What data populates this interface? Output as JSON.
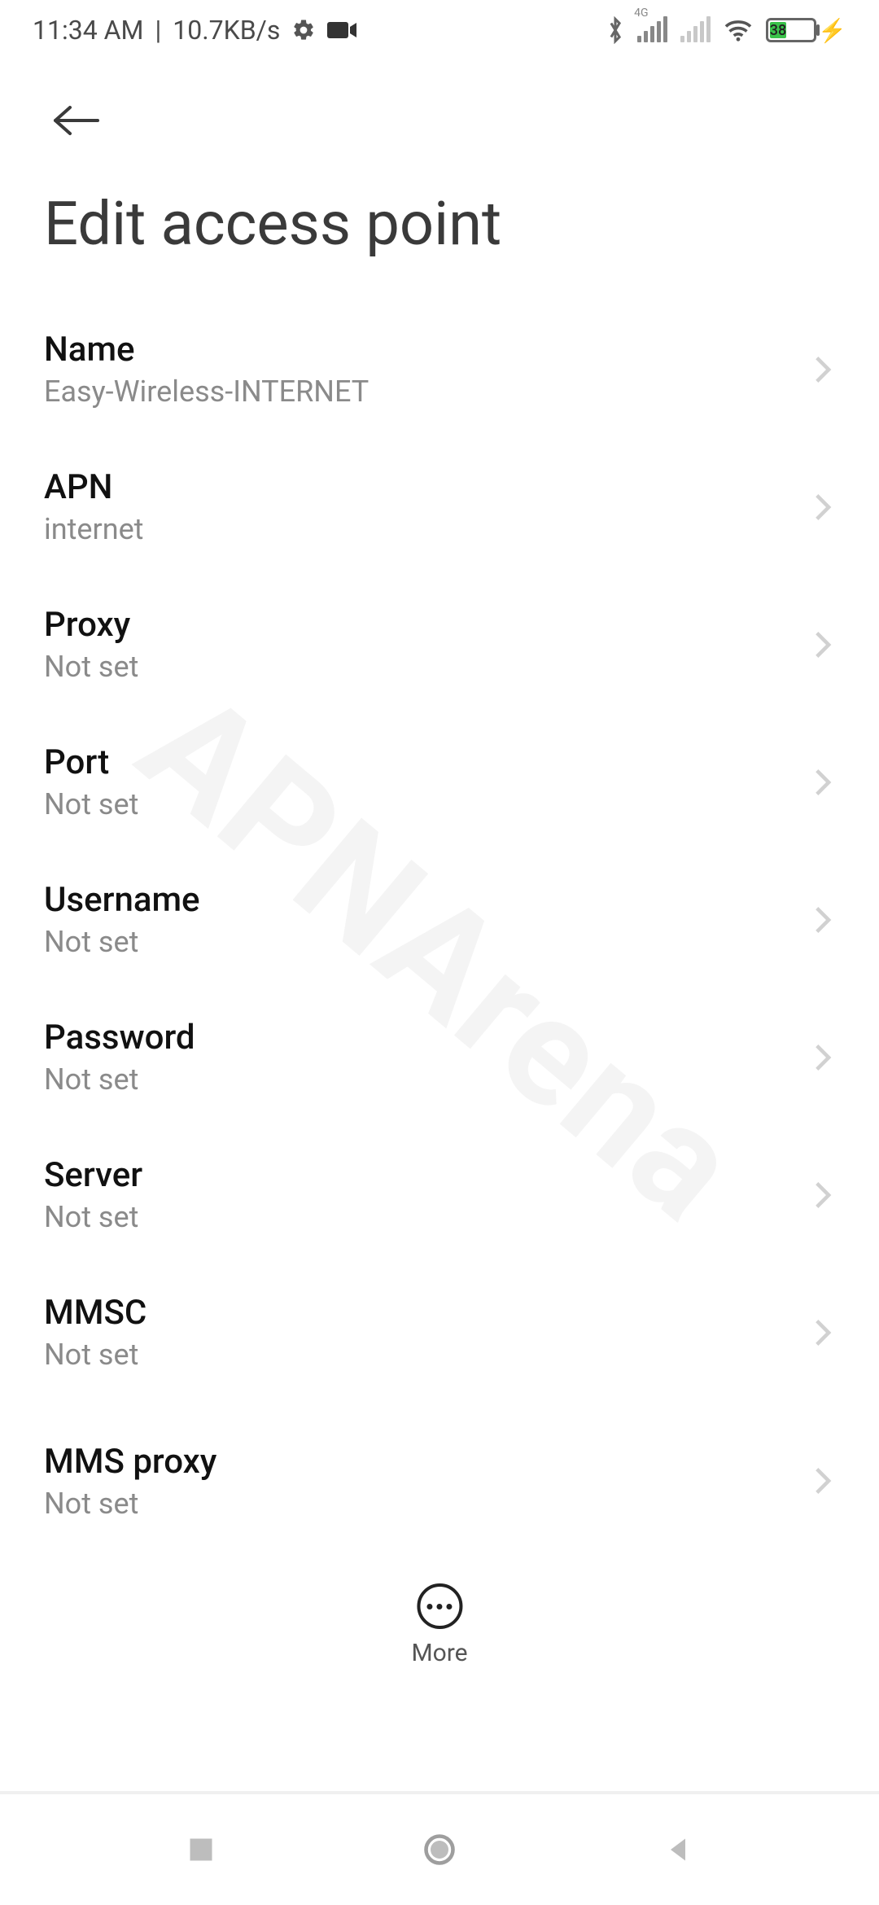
{
  "status": {
    "time": "11:34 AM",
    "net_speed": "10.7KB/s",
    "sim1_tech": "4G",
    "battery_pct": 38,
    "battery_text": "38"
  },
  "page": {
    "title": "Edit access point"
  },
  "fields": {
    "name": {
      "label": "Name",
      "value": "Easy-Wireless-INTERNET"
    },
    "apn": {
      "label": "APN",
      "value": "internet"
    },
    "proxy": {
      "label": "Proxy",
      "value": "Not set"
    },
    "port": {
      "label": "Port",
      "value": "Not set"
    },
    "username": {
      "label": "Username",
      "value": "Not set"
    },
    "password": {
      "label": "Password",
      "value": "Not set"
    },
    "server": {
      "label": "Server",
      "value": "Not set"
    },
    "mmsc": {
      "label": "MMSC",
      "value": "Not set"
    },
    "mms_proxy": {
      "label": "MMS proxy",
      "value": "Not set"
    }
  },
  "more_label": "More",
  "watermark": "APNArena"
}
